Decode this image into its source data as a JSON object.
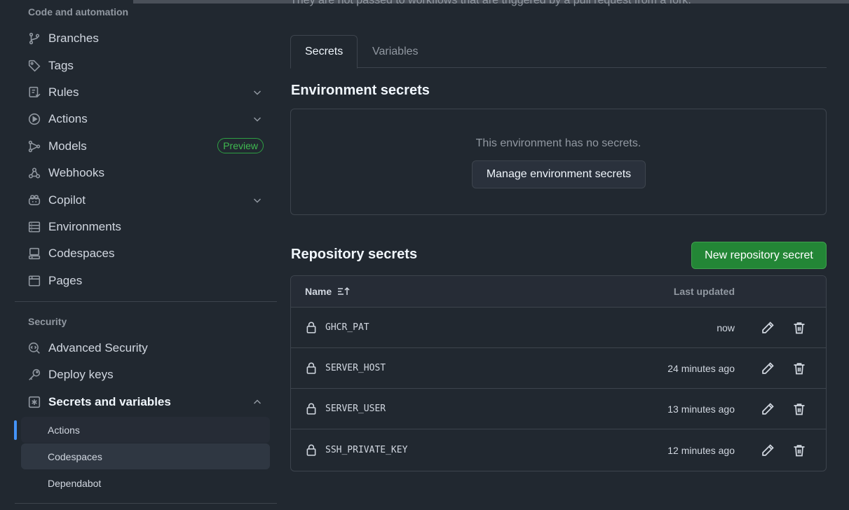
{
  "sidebar": {
    "code_heading": "Code and automation",
    "code_items": [
      {
        "label": "Branches",
        "icon": "branch-icon"
      },
      {
        "label": "Tags",
        "icon": "tag-icon"
      },
      {
        "label": "Rules",
        "icon": "rules-icon",
        "expandable": true
      },
      {
        "label": "Actions",
        "icon": "play-icon",
        "expandable": true
      },
      {
        "label": "Models",
        "icon": "models-icon",
        "badge": "Preview"
      },
      {
        "label": "Webhooks",
        "icon": "webhook-icon"
      },
      {
        "label": "Copilot",
        "icon": "copilot-icon",
        "expandable": true
      },
      {
        "label": "Environments",
        "icon": "server-icon"
      },
      {
        "label": "Codespaces",
        "icon": "codespaces-icon"
      },
      {
        "label": "Pages",
        "icon": "browser-icon"
      }
    ],
    "security_heading": "Security",
    "security_items": [
      {
        "label": "Advanced Security",
        "icon": "codescan-icon"
      },
      {
        "label": "Deploy keys",
        "icon": "key-icon"
      },
      {
        "label": "Secrets and variables",
        "icon": "asterisk-icon",
        "expanded": true
      }
    ],
    "sub_items": [
      "Actions",
      "Codespaces",
      "Dependabot"
    ],
    "active_sub_item": "Actions"
  },
  "main": {
    "intro_text": "They are not passed to workflows that are triggered by a pull request from a fork.",
    "tabs": [
      "Secrets",
      "Variables"
    ],
    "selected_tab": "Secrets",
    "env_heading": "Environment secrets",
    "env_empty_text": "This environment has no secrets.",
    "env_manage_button": "Manage environment secrets",
    "repo_heading": "Repository secrets",
    "new_secret_button": "New repository secret",
    "table": {
      "col_name": "Name",
      "col_updated": "Last updated",
      "rows": [
        {
          "name": "GHCR_PAT",
          "updated": "now"
        },
        {
          "name": "SERVER_HOST",
          "updated": "24 minutes ago"
        },
        {
          "name": "SERVER_USER",
          "updated": "13 minutes ago"
        },
        {
          "name": "SSH_PRIVATE_KEY",
          "updated": "12 minutes ago"
        }
      ]
    }
  },
  "colors": {
    "background": "#212830",
    "accent_blue": "#4493f8",
    "primary_green": "#238636",
    "border": "#3d444d"
  }
}
